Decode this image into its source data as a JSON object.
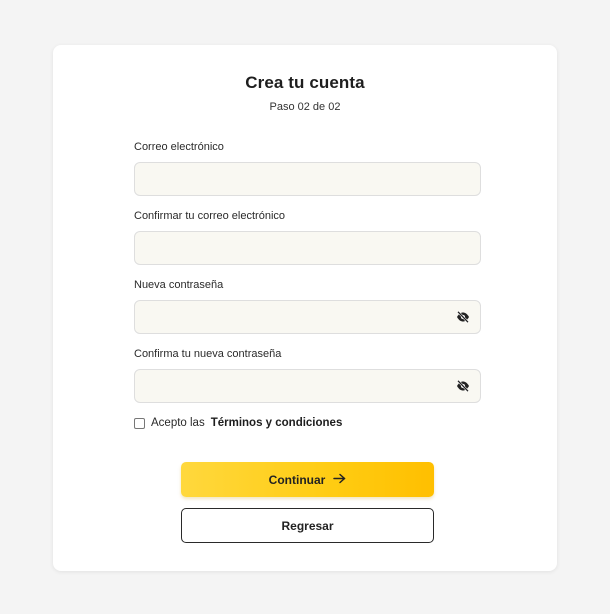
{
  "header": {
    "title": "Crea tu cuenta",
    "step": "Paso 02 de 02"
  },
  "fields": {
    "email": {
      "label": "Correo electrónico",
      "value": "",
      "placeholder": ""
    },
    "email_confirm": {
      "label": "Confirmar tu correo electrónico",
      "value": "",
      "placeholder": ""
    },
    "password": {
      "label": "Nueva contraseña",
      "value": "",
      "placeholder": "",
      "icon": "eye-slash-icon"
    },
    "password_confirm": {
      "label": "Confirma tu nueva contraseña",
      "value": "",
      "placeholder": "",
      "icon": "eye-slash-icon"
    }
  },
  "terms": {
    "prefix": "Acepto las",
    "link": "Términos y condiciones",
    "checked": false
  },
  "buttons": {
    "continue_label": "Continuar",
    "continue_icon": "arrow-right-icon",
    "back_label": "Regresar"
  },
  "colors": {
    "accent": "#ffcc12",
    "background": "#f4f4f4",
    "input_bg": "#f9f8f2"
  }
}
